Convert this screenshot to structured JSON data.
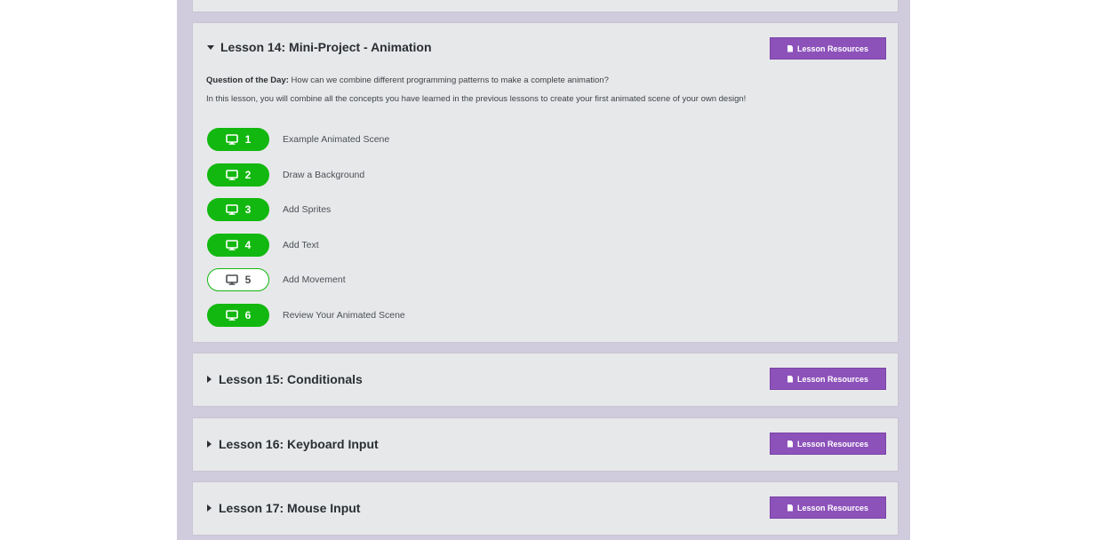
{
  "lessons": [
    {
      "title": "Lesson 14: Mini-Project - Animation",
      "expanded": true,
      "resources_label": "Lesson Resources",
      "question_label": "Question of the Day:",
      "question": "How can we combine different programming patterns to make a complete animation?",
      "description": "In this lesson, you will combine all the concepts you have learned in the previous lessons to create your first animated scene of your own design!",
      "steps": [
        {
          "number": "1",
          "label": "Example Animated Scene",
          "status": "complete"
        },
        {
          "number": "2",
          "label": "Draw a Background",
          "status": "complete"
        },
        {
          "number": "3",
          "label": "Add Sprites",
          "status": "complete"
        },
        {
          "number": "4",
          "label": "Add Text",
          "status": "complete"
        },
        {
          "number": "5",
          "label": "Add Movement",
          "status": "not-started"
        },
        {
          "number": "6",
          "label": "Review Your Animated Scene",
          "status": "complete"
        }
      ]
    },
    {
      "title": "Lesson 15: Conditionals",
      "expanded": false,
      "resources_label": "Lesson Resources"
    },
    {
      "title": "Lesson 16: Keyboard Input",
      "expanded": false,
      "resources_label": "Lesson Resources"
    },
    {
      "title": "Lesson 17: Mouse Input",
      "expanded": false,
      "resources_label": "Lesson Resources"
    }
  ],
  "icons": {
    "step_icon": "monitor-icon",
    "resources_icon": "document-icon",
    "expanded_caret": "caret-down-icon",
    "collapsed_caret": "caret-right-icon"
  },
  "colors": {
    "page_background": "#ffffff",
    "column_background": "#d0cbdd",
    "card_background": "#e7e8ea",
    "resources_button": "#8c52ba",
    "complete_green": "#12b80f"
  }
}
